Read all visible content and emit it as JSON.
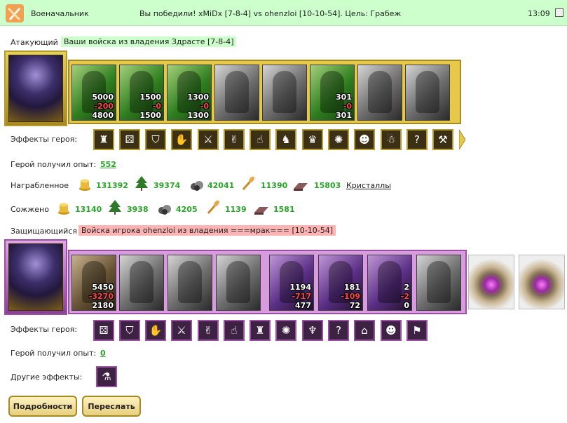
{
  "header": {
    "author": "Военачальник",
    "title": "Вы победили! xMiDx [7-8-4] vs ohenzloi [10-10-54]. Цель: Грабеж",
    "time": "13:09"
  },
  "attacker": {
    "label": "Атакующий",
    "tag": "Ваши войска из владения Здрасте [7-8-4]",
    "units": [
      {
        "top": "5000",
        "mid": "-200",
        "bot": "4800"
      },
      {
        "top": "1500",
        "mid": "-0",
        "bot": "1500"
      },
      {
        "top": "1300",
        "mid": "-0",
        "bot": "1300"
      },
      {
        "top": "",
        "mid": "",
        "bot": ""
      },
      {
        "top": "",
        "mid": "",
        "bot": ""
      },
      {
        "top": "301",
        "mid": "-0",
        "bot": "301"
      },
      {
        "top": "",
        "mid": "",
        "bot": ""
      },
      {
        "top": "",
        "mid": "",
        "bot": ""
      }
    ],
    "effects_label": "Эффекты героя:",
    "exp_label": "Герой получил опыт:",
    "exp_value": "552",
    "loot_label": "Награбленное",
    "loot": {
      "gold": "131392",
      "wood": "39374",
      "stone": "42041",
      "grain": "11390",
      "iron": "15803",
      "crystals": "Кристаллы"
    },
    "burned_label": "Сожжено",
    "burned": {
      "gold": "13140",
      "wood": "3938",
      "stone": "4205",
      "grain": "1139",
      "iron": "1581"
    }
  },
  "defender": {
    "label": "Защищающийся",
    "tag": "Войска игрока ohenzloi из владения ===мрак=== [10-10-54]",
    "units": [
      {
        "top": "5450",
        "mid": "-3270",
        "bot": "2180"
      },
      {
        "top": "",
        "mid": "",
        "bot": ""
      },
      {
        "top": "",
        "mid": "",
        "bot": ""
      },
      {
        "top": "",
        "mid": "",
        "bot": ""
      },
      {
        "top": "1194",
        "mid": "-717",
        "bot": "477"
      },
      {
        "top": "181",
        "mid": "-109",
        "bot": "72"
      },
      {
        "top": "2",
        "mid": "-2",
        "bot": "0"
      },
      {
        "top": "",
        "mid": "",
        "bot": ""
      }
    ],
    "effects_label": "Эффекты героя:",
    "exp_label": "Герой получил опыт:",
    "exp_value": "0",
    "other_effects_label": "Другие эффекты:"
  },
  "buttons": {
    "details": "Подробности",
    "forward": "Переслать"
  },
  "icons": {
    "attacker_effects": [
      "fortress-icon",
      "dice-icon",
      "shield-icon",
      "handshake-shield-icon",
      "sword-icon",
      "handshake-icon",
      "hand-blessing-icon",
      "armor-icon",
      "helmet-icon",
      "cobweb-icon",
      "mask-icon",
      "cloak-icon",
      "question-icon",
      "longsword-icon"
    ],
    "defender_effects": [
      "dice-icon",
      "shield-icon",
      "handshake-shield-icon",
      "sword-icon",
      "handshake-icon",
      "hand-blessing-icon",
      "fortress-icon",
      "cobweb-icon",
      "demon-icon",
      "question-icon",
      "fan-icon",
      "mask-icon",
      "banner-shield-icon"
    ]
  },
  "colors": {
    "title_bg": "#ccffcc",
    "attacker_tag_bg": "#ccffcc",
    "defender_tag_bg": "#ffb3b3",
    "gold_frame": "#e6c94b",
    "violet_frame": "#d99bdf",
    "value_green": "#2aa52a"
  }
}
